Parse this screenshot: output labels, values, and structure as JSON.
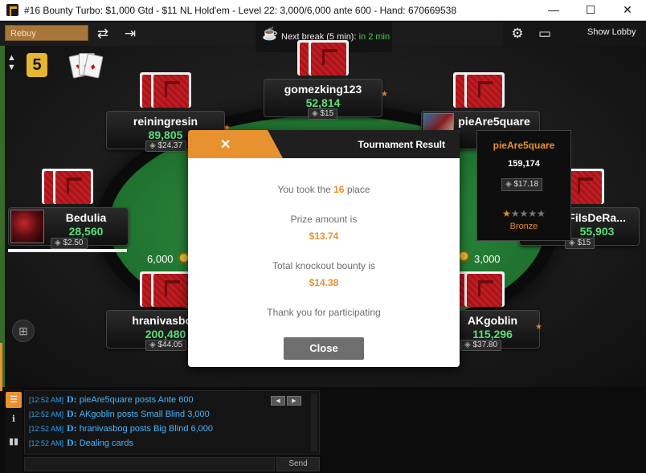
{
  "window": {
    "title": "#16 Bounty Turbo: $1,000 Gtd - $11 NL Hold'em - Level 22: 3,000/6,000 ante 600 - Hand: 670669538",
    "controls": {
      "minimize": "—",
      "maximize": "☐",
      "close": "✕"
    }
  },
  "toolbar": {
    "rebuy_label": "Rebuy",
    "next_break_label": "Next break (5 min):",
    "next_break_eta": "in 2 min",
    "show_lobby_label": "Show Lobby",
    "badge_level": "5"
  },
  "players": [
    {
      "name": "gomezking123",
      "stack": "52,814",
      "bounty": "$15"
    },
    {
      "name": "reiningresin",
      "stack": "89,805",
      "bounty": "$24.37"
    },
    {
      "name": "pieAre5quare",
      "stack": "159,174",
      "bounty": "$17.18"
    },
    {
      "name": "Bedulia",
      "stack": "28,560",
      "bounty": "$2.50"
    },
    {
      "name": "LesFilsDeRa...",
      "stack": "55,903",
      "bounty": "$15"
    },
    {
      "name": "hranivasbog",
      "stack": "200,480",
      "bounty": "$44.05"
    },
    {
      "name": "AKgoblin",
      "stack": "115,296",
      "bounty": "$37.80"
    }
  ],
  "table": {
    "bet_left": "6,000",
    "bet_right": "3,000"
  },
  "tooltip": {
    "name": "pieAre5quare",
    "stack": "159,174",
    "bounty": "$17.18",
    "stars_filled": 1,
    "stars_total": 5,
    "rank": "Bronze"
  },
  "modal": {
    "title": "Tournament Result",
    "close_x": "✕",
    "place_prefix": "You took the",
    "place_value": "16",
    "place_suffix": "place",
    "prize_label": "Prize amount is",
    "prize_value": "$13.74",
    "bounty_label": "Total knockout bounty is",
    "bounty_value": "$14.38",
    "thanks": "Thank you for participating",
    "close_button": "Close"
  },
  "chat": {
    "lines": [
      {
        "time": "[12:52 AM]",
        "text": "pieAre5quare  posts Ante 600"
      },
      {
        "time": "[12:52 AM]",
        "text": "AKgoblin  posts Small Blind 3,000"
      },
      {
        "time": "[12:52 AM]",
        "text": "hranivasbog  posts Big Blind 6,000"
      },
      {
        "time": "[12:52 AM]",
        "text": "Dealing cards"
      }
    ],
    "send_label": "Send"
  },
  "colors": {
    "accent": "#e8912f",
    "stack_green": "#5ae07a",
    "felt": "#237a33",
    "chat_blue": "#46b6ff"
  }
}
